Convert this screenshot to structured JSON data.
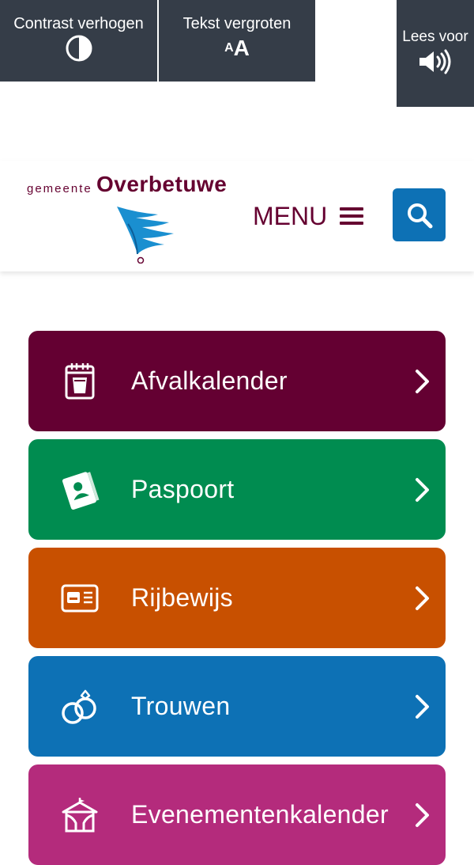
{
  "a11y_bar": {
    "contrast_label": "Contrast verhogen",
    "textsize_label": "Tekst vergroten",
    "textsize_small": "A",
    "textsize_big": "A",
    "read_label": "Lees voor"
  },
  "header": {
    "logo_prefix": "gemeente",
    "logo_name": "Overbetuwe",
    "menu_label": "MENU"
  },
  "tiles": [
    {
      "label": "Afvalkalender",
      "color": "#640032",
      "icon": "calendar-bin-icon"
    },
    {
      "label": "Paspoort",
      "color": "#008c50",
      "icon": "passport-icon"
    },
    {
      "label": "Rijbewijs",
      "color": "#c85000",
      "icon": "drivers-license-icon"
    },
    {
      "label": "Trouwen",
      "color": "#0d71b5",
      "icon": "wedding-rings-icon"
    },
    {
      "label": "Evenementenkalender",
      "color": "#b42b7c",
      "icon": "event-tent-icon"
    }
  ],
  "colors": {
    "toolbar": "#353d48",
    "brand": "#650030",
    "search": "#0d71b5"
  }
}
